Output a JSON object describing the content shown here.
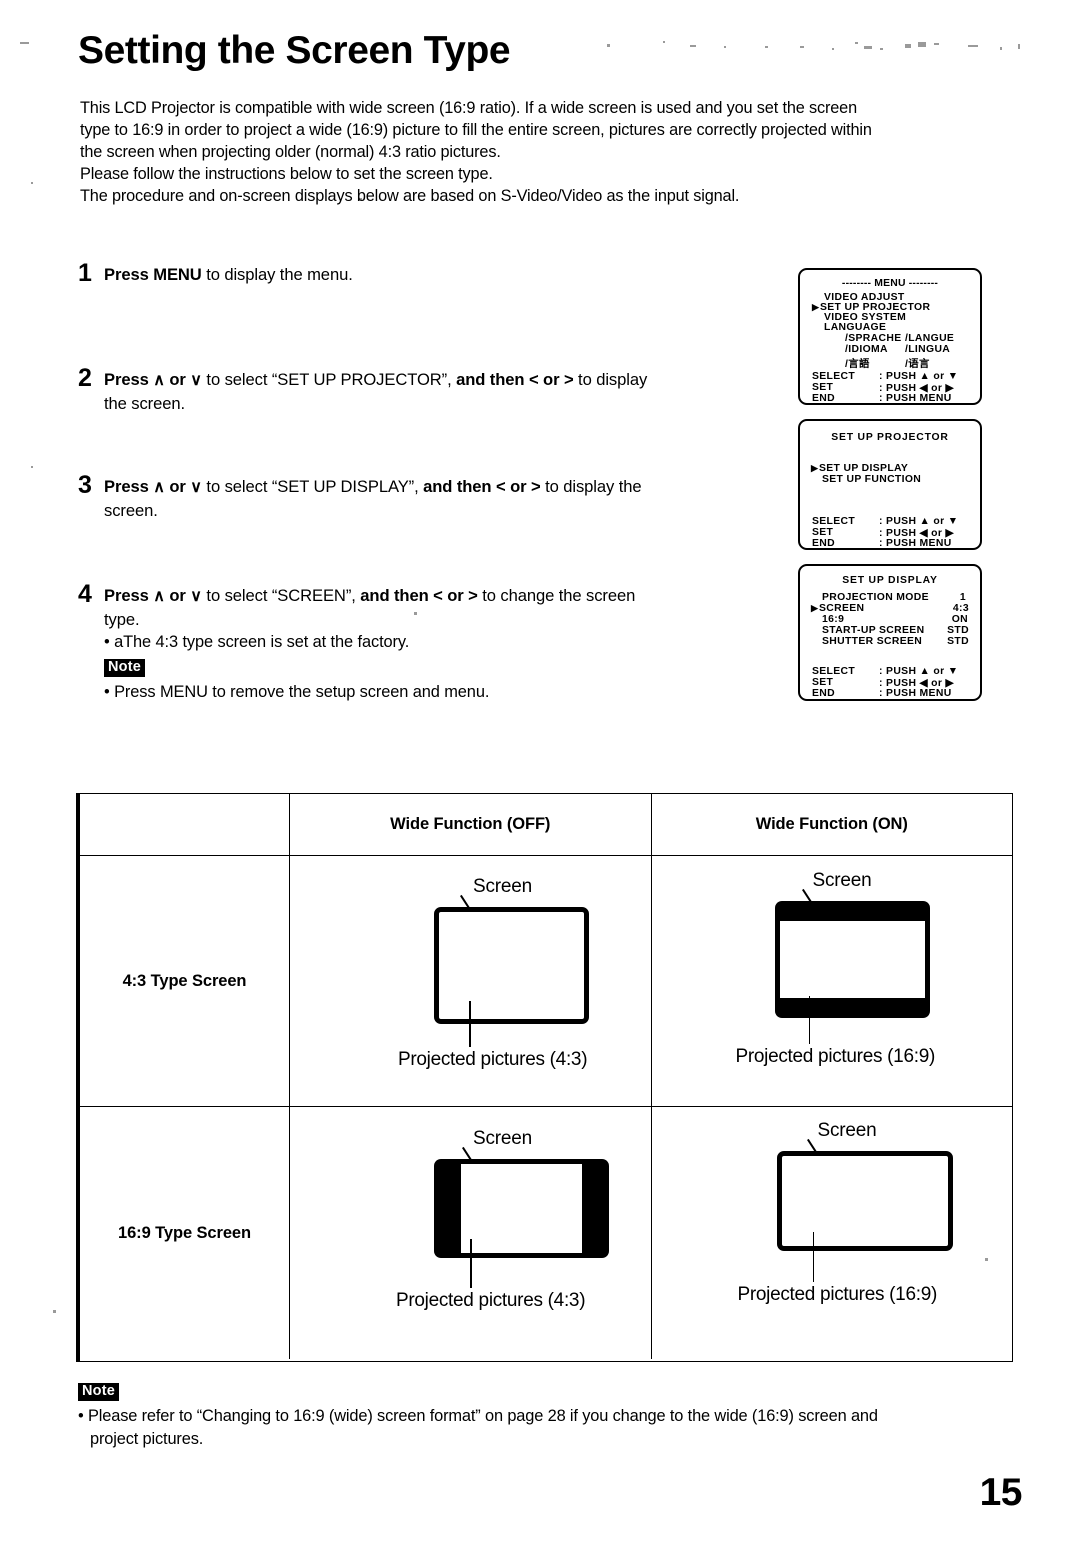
{
  "page": {
    "title": "Setting the Screen Type",
    "number": "15"
  },
  "intro": {
    "line1": "This LCD Projector is compatible with wide screen (16:9 ratio). If a wide screen is used and you set the screen",
    "line2": "type to 16:9 in order to project a wide (16:9) picture to fill the entire screen, pictures are correctly projected within",
    "line3": "the screen when projecting older (normal) 4:3 ratio pictures.",
    "line4": "Please follow the instructions below to set the screen type.",
    "line5": "The procedure and on-screen displays below are based on S-Video/Video as the input signal."
  },
  "steps": [
    {
      "num": "1",
      "press": "Press MENU",
      "tail": " to display the menu."
    },
    {
      "num": "2",
      "press": "Press",
      "up": "∧",
      "or": "or",
      "down": "∨",
      "mid": " to select “SET UP PROJECTOR”, ",
      "and_then": "and then < or >",
      "tail": " to display",
      "line2": "the screen."
    },
    {
      "num": "3",
      "press": "Press",
      "up": "∧",
      "or": "or",
      "down": "∨",
      "mid": " to select “SET UP DISPLAY”, ",
      "and_then": "and then < or >",
      "tail": " to display the",
      "line2": "screen."
    },
    {
      "num": "4",
      "press": "Press",
      "up": "∧",
      "or": "or",
      "down": "∨",
      "mid": " to select “SCREEN”, ",
      "and_then": "and then < or >",
      "tail": " to change the screen",
      "line2": "type.",
      "bullet": "• aThe 4:3 type screen is set at the factory.",
      "note_badge": "Note",
      "note_bullet": "• Press MENU to remove the setup screen and menu."
    }
  ],
  "osd": {
    "menu": {
      "title": "-------- MENU --------",
      "items": [
        {
          "label": "VIDEO ADJUST",
          "selected": false
        },
        {
          "label": "SET UP PROJECTOR",
          "selected": true
        },
        {
          "label": "VIDEO SYSTEM",
          "selected": false
        },
        {
          "label": "LANGUAGE",
          "selected": false
        }
      ],
      "lang_a1": "/SPRACHE",
      "lang_a2": "/LANGUE",
      "lang_b1": "/IDIOMA",
      "lang_b2": "/LINGUA",
      "lang_c1": "/言語",
      "lang_c2": "/语言",
      "legend": [
        {
          "key": "SELECT",
          "val": ": PUSH ▲ or ▼"
        },
        {
          "key": "SET",
          "val": ": PUSH ◀ or ▶"
        },
        {
          "key": "END",
          "val": ": PUSH MENU"
        }
      ]
    },
    "projector": {
      "title": "SET UP PROJECTOR",
      "items": [
        {
          "label": "SET UP DISPLAY",
          "selected": true
        },
        {
          "label": "SET UP FUNCTION",
          "selected": false
        }
      ],
      "legend": [
        {
          "key": "SELECT",
          "val": ": PUSH ▲ or ▼"
        },
        {
          "key": "SET",
          "val": ": PUSH ◀ or ▶"
        },
        {
          "key": "END",
          "val": ": PUSH MENU"
        }
      ]
    },
    "display": {
      "title": "SET UP DISPLAY",
      "items": [
        {
          "label": "PROJECTION MODE",
          "value": "1",
          "selected": false
        },
        {
          "label": "SCREEN",
          "value": "4:3",
          "selected": true
        },
        {
          "label": "16:9",
          "value": "ON",
          "selected": false
        },
        {
          "label": "START-UP SCREEN",
          "value": "STD",
          "selected": false
        },
        {
          "label": "SHUTTER SCREEN",
          "value": "STD",
          "selected": false
        }
      ],
      "legend": [
        {
          "key": "SELECT",
          "val": ": PUSH ▲ or ▼"
        },
        {
          "key": "SET",
          "val": ": PUSH ◀ or ▶"
        },
        {
          "key": "END",
          "val": ": PUSH MENU"
        }
      ]
    }
  },
  "table": {
    "corner": "",
    "headers": {
      "off": "Wide Function (OFF)",
      "on": "Wide Function (ON)"
    },
    "rows": [
      {
        "label": "4:3 Type Screen",
        "cells": [
          {
            "screen_label": "Screen",
            "projected_label": "Projected pictures (4:3)",
            "mask": "none"
          },
          {
            "screen_label": "Screen",
            "projected_label": "Projected pictures (16:9)",
            "mask": "letterbox"
          }
        ]
      },
      {
        "label": "16:9 Type Screen",
        "cells": [
          {
            "screen_label": "Screen",
            "projected_label": "Projected pictures (4:3)",
            "mask": "pillarbox"
          },
          {
            "screen_label": "Screen",
            "projected_label": "Projected pictures (16:9)",
            "mask": "none"
          }
        ]
      }
    ]
  },
  "bottom_note": {
    "badge": "Note",
    "line1": "• Please refer to “Changing to 16:9 (wide) screen format” on page 28 if you change to the wide (16:9) screen and",
    "line2": "project pictures."
  }
}
